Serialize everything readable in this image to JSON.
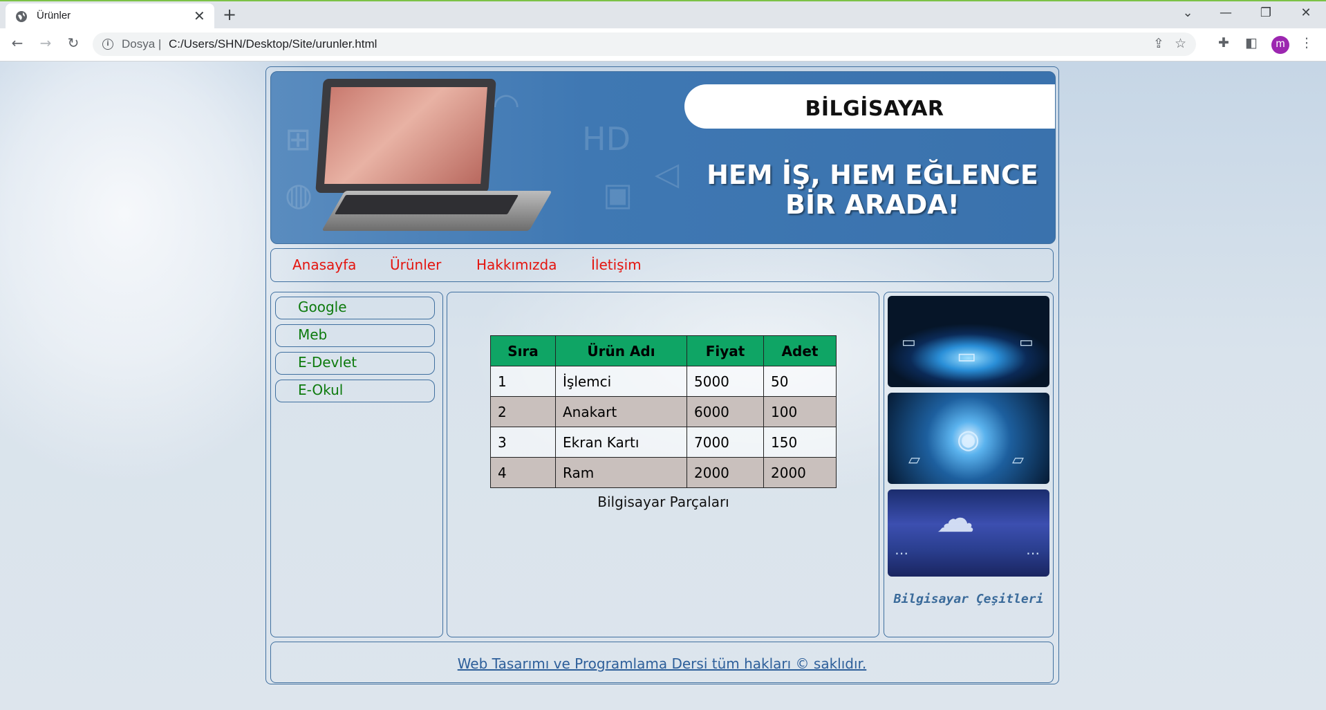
{
  "browser": {
    "tab_title": "Ürünler",
    "tab_close": "✕",
    "new_tab": "+",
    "url_scheme": "Dosya",
    "url_separator": "|",
    "url": "C:/Users/SHN/Desktop/Site/urunler.html",
    "avatar_letter": "m"
  },
  "banner": {
    "brand": "BİLGİSAYAR",
    "slogan_line1": "HEM İŞ, HEM EĞLENCE",
    "slogan_line2": "BİR ARADA!"
  },
  "menu": {
    "items": [
      "Anasayfa",
      "Ürünler",
      "Hakkımızda",
      "İletişim"
    ]
  },
  "sidebar_left": {
    "links": [
      "Google",
      "Meb",
      "E-Devlet",
      "E-Okul"
    ]
  },
  "products_table": {
    "headers": [
      "Sıra",
      "Ürün Adı",
      "Fiyat",
      "Adet"
    ],
    "rows": [
      [
        "1",
        "İşlemci",
        "5000",
        "50"
      ],
      [
        "2",
        "Anakart",
        "6000",
        "100"
      ],
      [
        "3",
        "Ekran Kartı",
        "7000",
        "150"
      ],
      [
        "4",
        "Ram",
        "2000",
        "2000"
      ]
    ],
    "caption": "Bilgisayar Parçaları"
  },
  "sidebar_right": {
    "caption": "Bilgisayar Çeşitleri"
  },
  "footer": {
    "text": "Web Tasarımı ve Programlama Dersi tüm hakları © saklıdır."
  },
  "colors": {
    "menu_link": "#e4140e",
    "side_link": "#0d7a0d",
    "table_header": "#0fa565",
    "table_alt_row": "#c9c0bd",
    "border": "#3f6f9f",
    "browser_accent": "#7cc246",
    "avatar": "#9c27b0"
  }
}
